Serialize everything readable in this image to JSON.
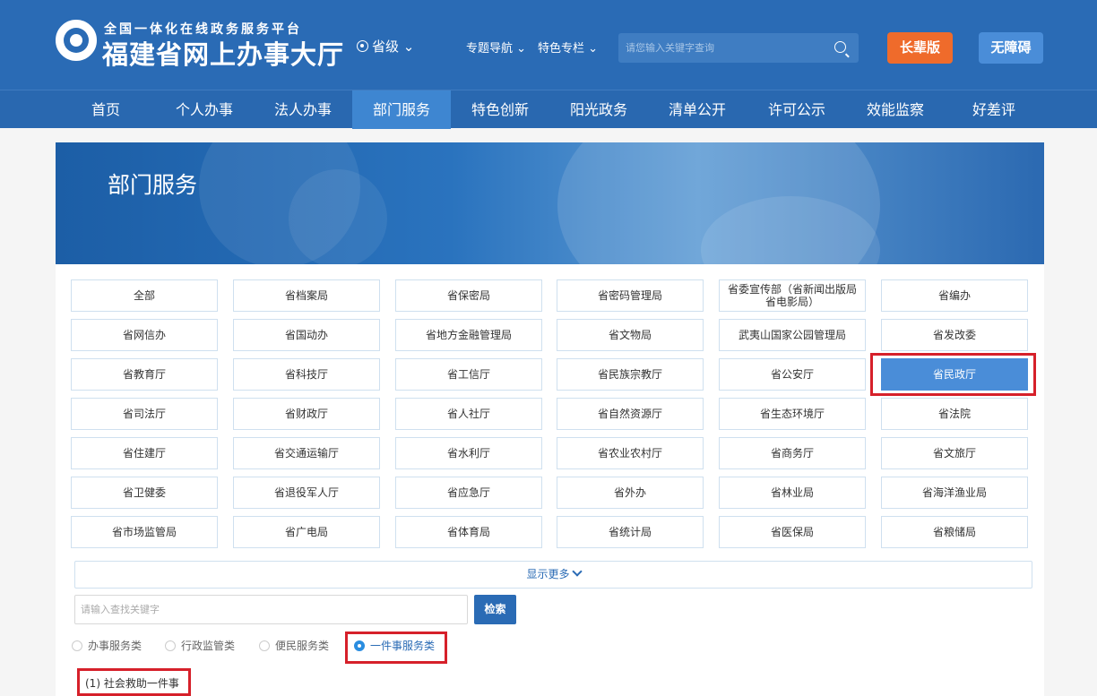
{
  "header": {
    "subtitle": "全国一体化在线政务服务平台",
    "title": "福建省网上办事大厅",
    "region": "省级",
    "topic_nav": "专题导航",
    "feature_column": "特色专栏",
    "search_placeholder": "请您输入关键字查询",
    "elder_button": "长辈版",
    "accessible_button": "无障碍"
  },
  "main_nav": [
    "首页",
    "个人办事",
    "法人办事",
    "部门服务",
    "特色创新",
    "阳光政务",
    "清单公开",
    "许可公示",
    "效能监察",
    "好差评"
  ],
  "main_nav_active": "部门服务",
  "banner": {
    "title": "部门服务"
  },
  "departments": [
    [
      "全部",
      "省档案局",
      "省保密局",
      "省密码管理局",
      "省委宣传部（省新闻出版局 省电影局）",
      "省编办"
    ],
    [
      "省网信办",
      "省国动办",
      "省地方金融管理局",
      "省文物局",
      "武夷山国家公园管理局",
      "省发改委"
    ],
    [
      "省教育厅",
      "省科技厅",
      "省工信厅",
      "省民族宗教厅",
      "省公安厅",
      "省民政厅"
    ],
    [
      "省司法厅",
      "省财政厅",
      "省人社厅",
      "省自然资源厅",
      "省生态环境厅",
      "省法院"
    ],
    [
      "省住建厅",
      "省交通运输厅",
      "省水利厅",
      "省农业农村厅",
      "省商务厅",
      "省文旅厅"
    ],
    [
      "省卫健委",
      "省退役军人厅",
      "省应急厅",
      "省外办",
      "省林业局",
      "省海洋渔业局"
    ],
    [
      "省市场监管局",
      "省广电局",
      "省体育局",
      "省统计局",
      "省医保局",
      "省粮储局"
    ]
  ],
  "selected_department": "省民政厅",
  "show_more": "显示更多",
  "keyword_placeholder": "请输入查找关键字",
  "search_button": "检索",
  "service_types": [
    "办事服务类",
    "行政监管类",
    "便民服务类",
    "一件事服务类"
  ],
  "selected_service_type": "一件事服务类",
  "results": [
    "(1) 社会救助一件事"
  ],
  "colors": {
    "brand_blue": "#2a6bb5",
    "accent_orange": "#ef6b2b",
    "highlight_red": "#d6202a"
  }
}
